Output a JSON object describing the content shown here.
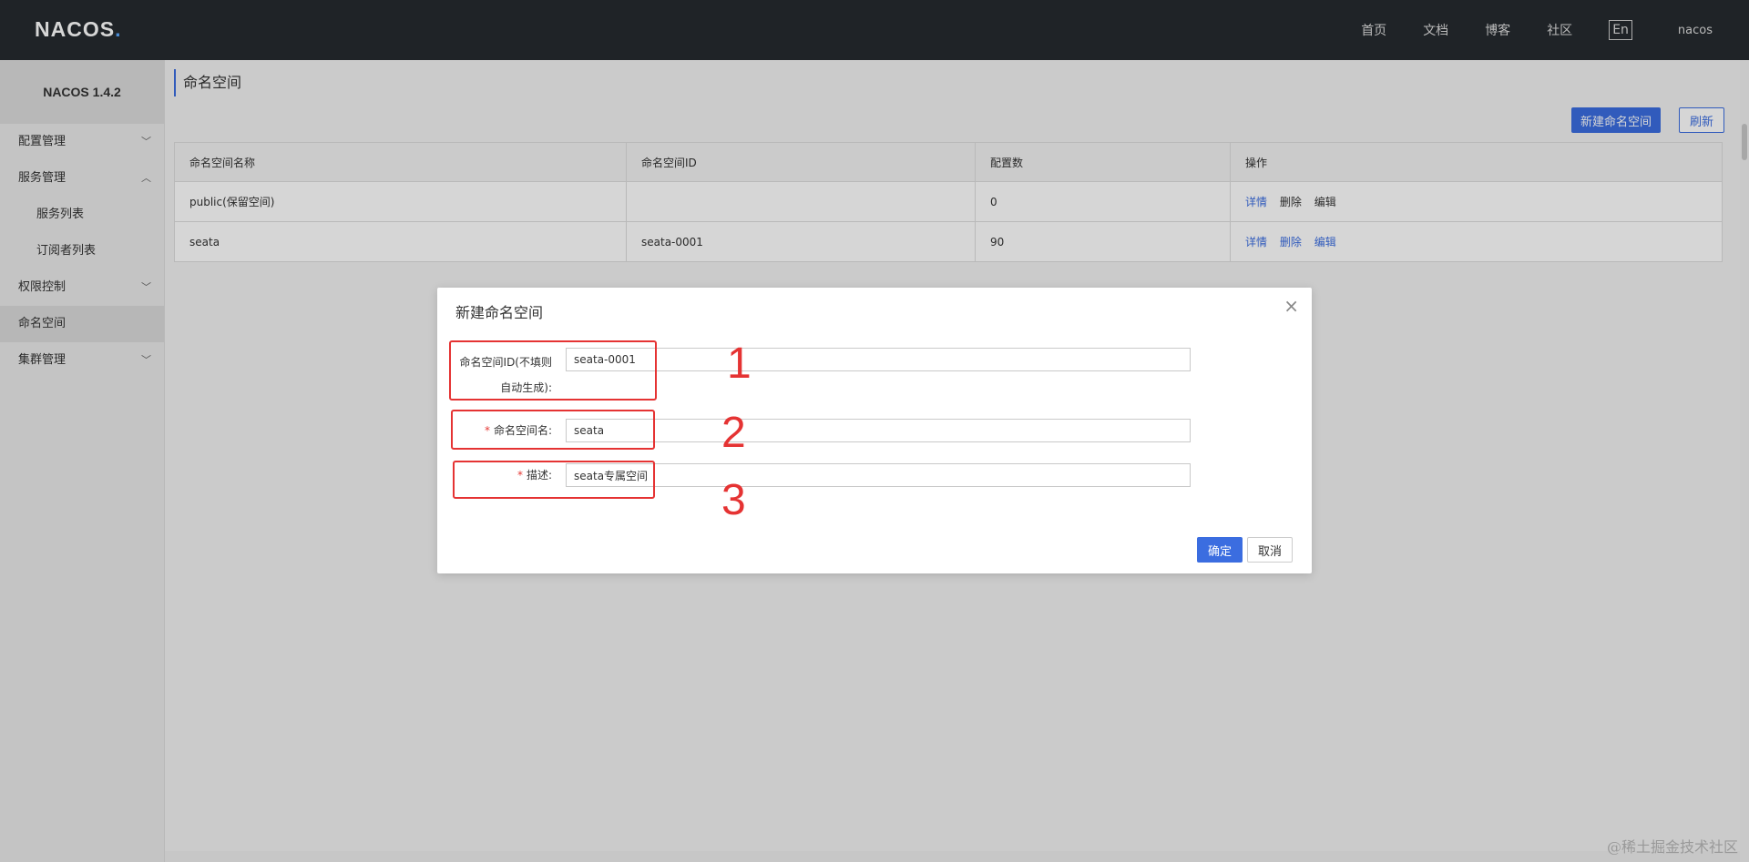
{
  "header": {
    "logo": "NACOS",
    "logo_dot": ".",
    "nav": [
      "首页",
      "文档",
      "博客",
      "社区"
    ],
    "lang": "En",
    "user": "nacos"
  },
  "sidebar": {
    "version": "NACOS 1.4.2",
    "items": [
      {
        "label": "配置管理",
        "type": "group",
        "expanded": false
      },
      {
        "label": "服务管理",
        "type": "group",
        "expanded": true
      },
      {
        "label": "服务列表",
        "type": "sub"
      },
      {
        "label": "订阅者列表",
        "type": "sub"
      },
      {
        "label": "权限控制",
        "type": "group",
        "expanded": false
      },
      {
        "label": "命名空间",
        "type": "item",
        "active": true
      },
      {
        "label": "集群管理",
        "type": "group",
        "expanded": false
      }
    ]
  },
  "main": {
    "title": "命名空间",
    "new_button": "新建命名空间",
    "refresh_button": "刷新",
    "table": {
      "columns": [
        "命名空间名称",
        "命名空间ID",
        "配置数",
        "操作"
      ],
      "rows": [
        {
          "name": "public(保留空间)",
          "id": "",
          "count": "0",
          "ops": [
            "详情",
            "删除",
            "编辑"
          ]
        },
        {
          "name": "seata",
          "id": "seata-0001",
          "count": "90",
          "ops": [
            "详情",
            "删除",
            "编辑"
          ]
        }
      ]
    }
  },
  "dialog": {
    "title": "新建命名空间",
    "close": "×",
    "fields": {
      "ns_id_label_line1": "命名空间ID(不填则",
      "ns_id_label_line2": "自动生成):",
      "ns_id_value": "seata-0001",
      "ns_name_label": "命名空间名:",
      "ns_name_value": "seata",
      "desc_label": "描述:",
      "desc_value": "seata专属空间",
      "required_mark": "*"
    },
    "confirm": "确定",
    "cancel": "取消"
  },
  "annotations": [
    "1",
    "2",
    "3"
  ],
  "watermark": "@稀土掘金技术社区",
  "colors": {
    "accent": "#3b6de0",
    "header_bg": "#252a2f",
    "annotation": "#e53333",
    "required": "#e53935"
  }
}
